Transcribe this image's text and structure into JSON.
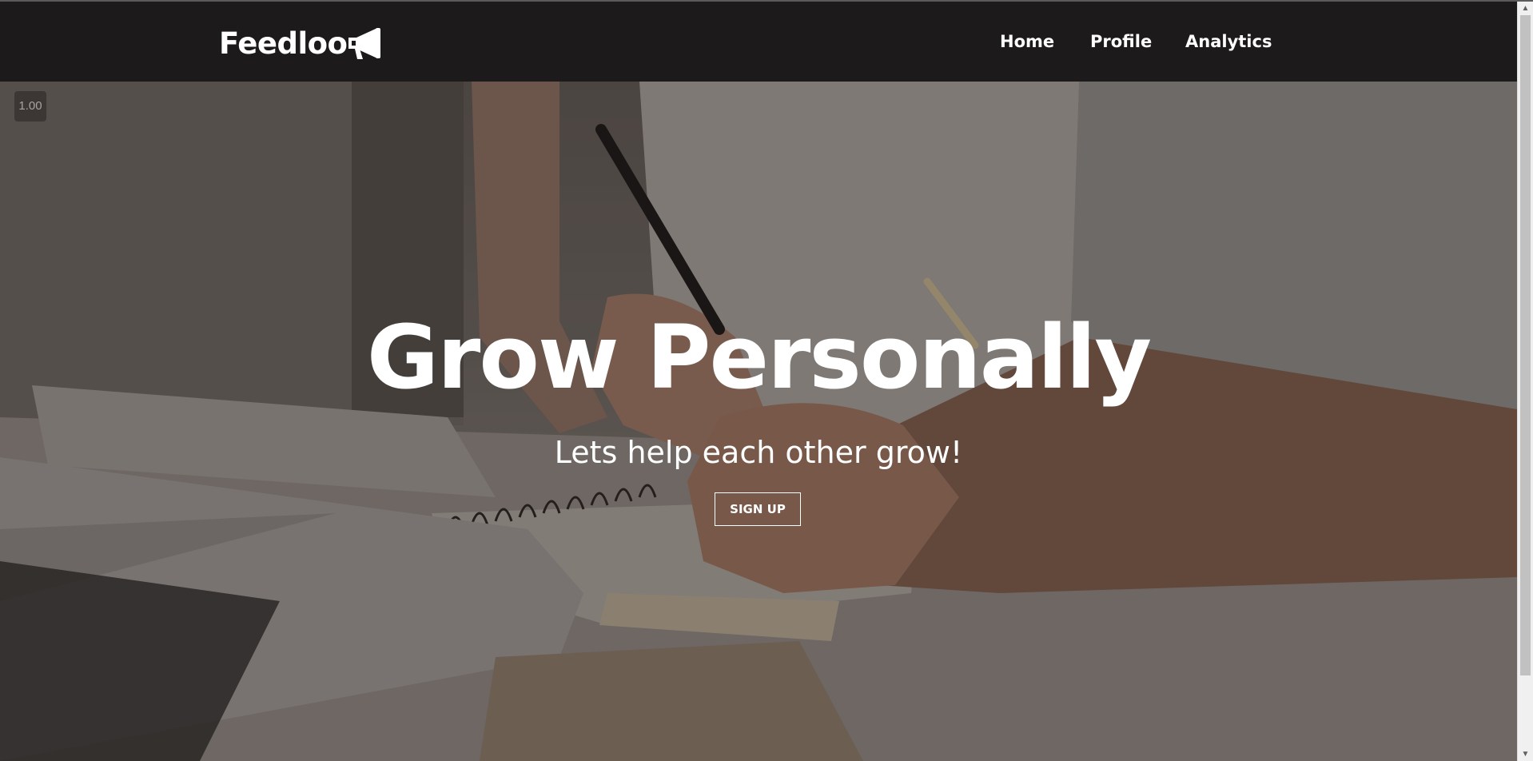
{
  "navbar": {
    "brand": "Feedloo",
    "brand_icon": "megaphone-icon",
    "links": [
      {
        "label": "Home"
      },
      {
        "label": "Profile"
      },
      {
        "label": "Analytics"
      }
    ]
  },
  "hero": {
    "zoom": "1.00",
    "title": "Grow Personally",
    "subtitle": "Lets help each other grow!",
    "cta": "SIGN UP"
  },
  "colors": {
    "navbar_bg": "#1c1a1b",
    "text": "#ffffff"
  }
}
